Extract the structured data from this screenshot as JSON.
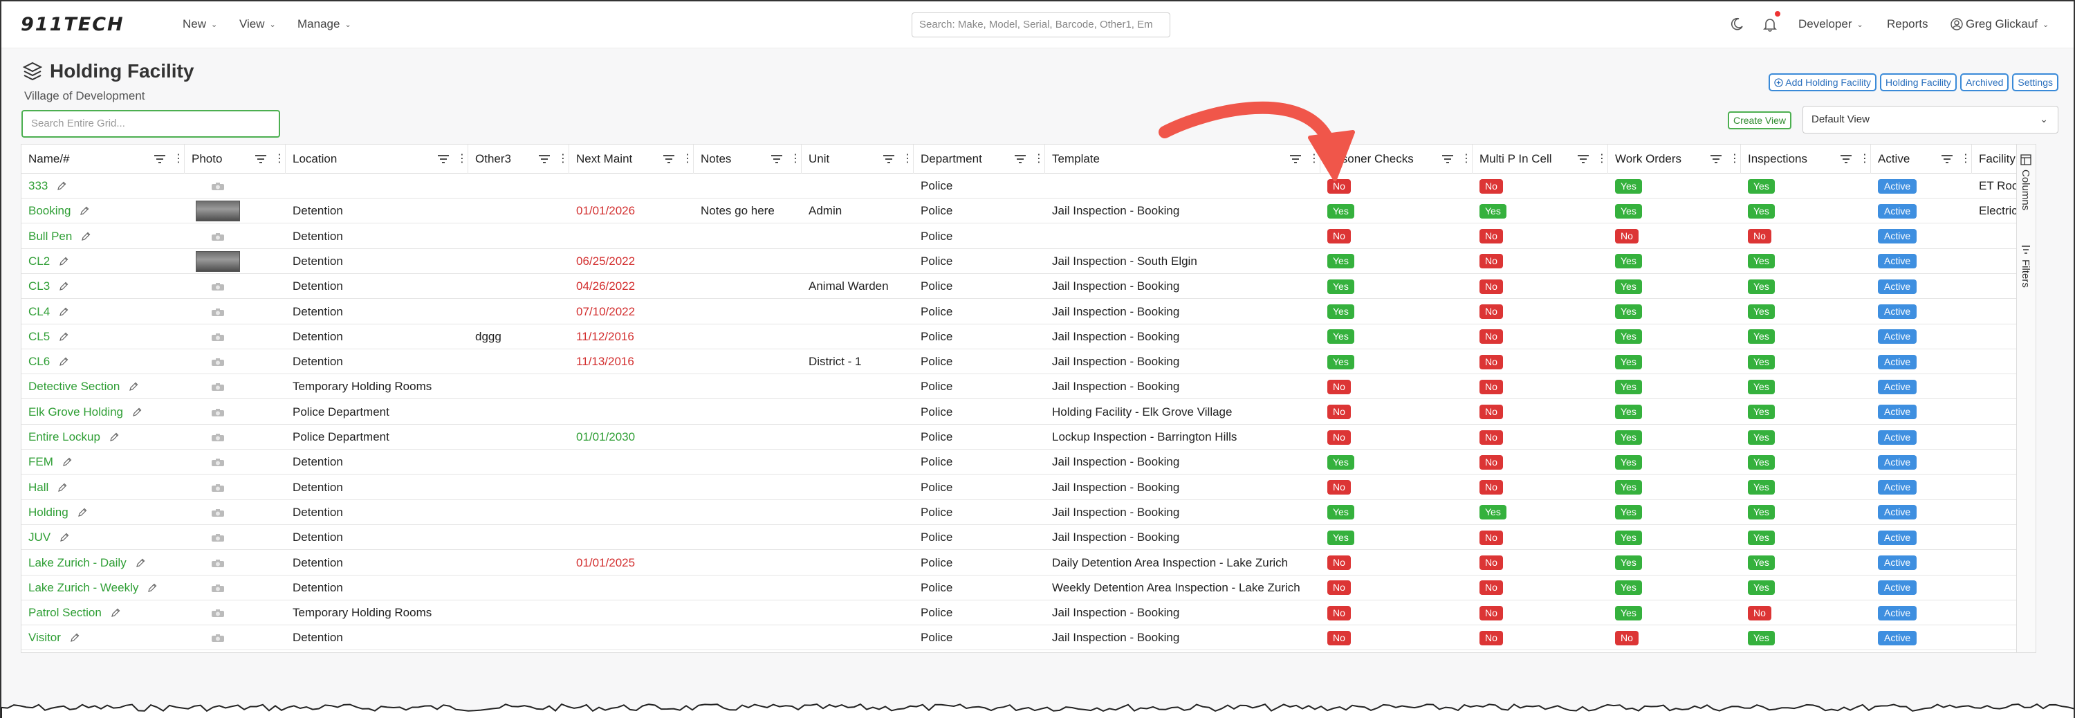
{
  "nav": {
    "logo": "911TECH",
    "new": "New",
    "view": "View",
    "manage": "Manage",
    "search_placeholder": "Search: Make, Model, Serial, Barcode, Other1, Em",
    "developer": "Developer",
    "reports": "Reports",
    "user": "Greg Glickauf"
  },
  "page": {
    "title": "Holding Facility",
    "subtitle": "Village of Development",
    "grid_search_placeholder": "Search Entire Grid...",
    "buttons": {
      "add": "Add Holding Facility",
      "holding": "Holding Facility",
      "archived": "Archived",
      "settings": "Settings"
    },
    "create_view": "Create View",
    "view_selected": "Default View"
  },
  "grid": {
    "columns": {
      "name": "Name/#",
      "photo": "Photo",
      "location": "Location",
      "other3": "Other3",
      "next_maint": "Next Maint",
      "notes": "Notes",
      "unit": "Unit",
      "department": "Department",
      "template": "Template",
      "prisoner_checks": "Prisoner Checks",
      "multi_p": "Multi P In Cell",
      "work_orders": "Work Orders",
      "inspections": "Inspections",
      "active": "Active",
      "facility": "Facility"
    },
    "side_tabs": {
      "columns": "Columns",
      "filters": "Filters"
    },
    "rows": [
      {
        "name": "333",
        "photo": "placeholder",
        "location": "",
        "other3": "",
        "next_maint": "",
        "next_maint_color": "",
        "notes": "",
        "unit": "",
        "department": "Police",
        "template": "",
        "prisoner_checks": "No",
        "multi_p": "No",
        "work_orders": "Yes",
        "inspections": "Yes",
        "active": "Active",
        "facility": "ET Room"
      },
      {
        "name": "Booking",
        "photo": "image",
        "location": "Detention",
        "other3": "",
        "next_maint": "01/01/2026",
        "next_maint_color": "red",
        "notes": "Notes go here",
        "unit": "Admin",
        "department": "Police",
        "template": "Jail Inspection - Booking",
        "prisoner_checks": "Yes",
        "multi_p": "Yes",
        "work_orders": "Yes",
        "inspections": "Yes",
        "active": "Active",
        "facility": "Electrical Clos"
      },
      {
        "name": "Bull Pen",
        "photo": "placeholder",
        "location": "Detention",
        "other3": "",
        "next_maint": "",
        "next_maint_color": "",
        "notes": "",
        "unit": "",
        "department": "Police",
        "template": "",
        "prisoner_checks": "No",
        "multi_p": "No",
        "work_orders": "No",
        "inspections": "No",
        "active": "Active",
        "facility": ""
      },
      {
        "name": "CL2",
        "photo": "image",
        "location": "Detention",
        "other3": "",
        "next_maint": "06/25/2022",
        "next_maint_color": "red",
        "notes": "",
        "unit": "",
        "department": "Police",
        "template": "Jail Inspection - South Elgin",
        "prisoner_checks": "Yes",
        "multi_p": "No",
        "work_orders": "Yes",
        "inspections": "Yes",
        "active": "Active",
        "facility": ""
      },
      {
        "name": "CL3",
        "photo": "placeholder",
        "location": "Detention",
        "other3": "",
        "next_maint": "04/26/2022",
        "next_maint_color": "red",
        "notes": "",
        "unit": "Animal Warden",
        "department": "Police",
        "template": "Jail Inspection - Booking",
        "prisoner_checks": "Yes",
        "multi_p": "No",
        "work_orders": "Yes",
        "inspections": "Yes",
        "active": "Active",
        "facility": ""
      },
      {
        "name": "CL4",
        "photo": "placeholder",
        "location": "Detention",
        "other3": "",
        "next_maint": "07/10/2022",
        "next_maint_color": "red",
        "notes": "",
        "unit": "",
        "department": "Police",
        "template": "Jail Inspection - Booking",
        "prisoner_checks": "Yes",
        "multi_p": "No",
        "work_orders": "Yes",
        "inspections": "Yes",
        "active": "Active",
        "facility": ""
      },
      {
        "name": "CL5",
        "photo": "placeholder",
        "location": "Detention",
        "other3": "dggg",
        "next_maint": "11/12/2016",
        "next_maint_color": "red",
        "notes": "",
        "unit": "",
        "department": "Police",
        "template": "Jail Inspection - Booking",
        "prisoner_checks": "Yes",
        "multi_p": "No",
        "work_orders": "Yes",
        "inspections": "Yes",
        "active": "Active",
        "facility": ""
      },
      {
        "name": "CL6",
        "photo": "placeholder",
        "location": "Detention",
        "other3": "",
        "next_maint": "11/13/2016",
        "next_maint_color": "red",
        "notes": "",
        "unit": "District - 1",
        "department": "Police",
        "template": "Jail Inspection - Booking",
        "prisoner_checks": "Yes",
        "multi_p": "No",
        "work_orders": "Yes",
        "inspections": "Yes",
        "active": "Active",
        "facility": ""
      },
      {
        "name": "Detective Section",
        "photo": "placeholder",
        "location": "Temporary Holding Rooms",
        "other3": "",
        "next_maint": "",
        "next_maint_color": "",
        "notes": "",
        "unit": "",
        "department": "Police",
        "template": "Jail Inspection - Booking",
        "prisoner_checks": "No",
        "multi_p": "No",
        "work_orders": "Yes",
        "inspections": "Yes",
        "active": "Active",
        "facility": ""
      },
      {
        "name": "Elk Grove Holding",
        "photo": "placeholder",
        "location": "Police Department",
        "other3": "",
        "next_maint": "",
        "next_maint_color": "",
        "notes": "",
        "unit": "",
        "department": "Police",
        "template": "Holding Facility - Elk Grove Village",
        "prisoner_checks": "No",
        "multi_p": "No",
        "work_orders": "Yes",
        "inspections": "Yes",
        "active": "Active",
        "facility": ""
      },
      {
        "name": "Entire Lockup",
        "photo": "placeholder",
        "location": "Police Department",
        "other3": "",
        "next_maint": "01/01/2030",
        "next_maint_color": "green",
        "notes": "",
        "unit": "",
        "department": "Police",
        "template": "Lockup Inspection - Barrington Hills",
        "prisoner_checks": "No",
        "multi_p": "No",
        "work_orders": "Yes",
        "inspections": "Yes",
        "active": "Active",
        "facility": ""
      },
      {
        "name": "FEM",
        "photo": "placeholder",
        "location": "Detention",
        "other3": "",
        "next_maint": "",
        "next_maint_color": "",
        "notes": "",
        "unit": "",
        "department": "Police",
        "template": "Jail Inspection - Booking",
        "prisoner_checks": "Yes",
        "multi_p": "No",
        "work_orders": "Yes",
        "inspections": "Yes",
        "active": "Active",
        "facility": ""
      },
      {
        "name": "Hall",
        "photo": "placeholder",
        "location": "Detention",
        "other3": "",
        "next_maint": "",
        "next_maint_color": "",
        "notes": "",
        "unit": "",
        "department": "Police",
        "template": "Jail Inspection - Booking",
        "prisoner_checks": "No",
        "multi_p": "No",
        "work_orders": "Yes",
        "inspections": "Yes",
        "active": "Active",
        "facility": ""
      },
      {
        "name": "Holding",
        "photo": "placeholder",
        "location": "Detention",
        "other3": "",
        "next_maint": "",
        "next_maint_color": "",
        "notes": "",
        "unit": "",
        "department": "Police",
        "template": "Jail Inspection - Booking",
        "prisoner_checks": "Yes",
        "multi_p": "Yes",
        "work_orders": "Yes",
        "inspections": "Yes",
        "active": "Active",
        "facility": ""
      },
      {
        "name": "JUV",
        "photo": "placeholder",
        "location": "Detention",
        "other3": "",
        "next_maint": "",
        "next_maint_color": "",
        "notes": "",
        "unit": "",
        "department": "Police",
        "template": "Jail Inspection - Booking",
        "prisoner_checks": "Yes",
        "multi_p": "No",
        "work_orders": "Yes",
        "inspections": "Yes",
        "active": "Active",
        "facility": ""
      },
      {
        "name": "Lake Zurich - Daily",
        "photo": "placeholder",
        "location": "Detention",
        "other3": "",
        "next_maint": "01/01/2025",
        "next_maint_color": "red",
        "notes": "",
        "unit": "",
        "department": "Police",
        "template": "Daily Detention Area Inspection - Lake Zurich",
        "prisoner_checks": "No",
        "multi_p": "No",
        "work_orders": "Yes",
        "inspections": "Yes",
        "active": "Active",
        "facility": ""
      },
      {
        "name": "Lake Zurich - Weekly",
        "photo": "placeholder",
        "location": "Detention",
        "other3": "",
        "next_maint": "",
        "next_maint_color": "",
        "notes": "",
        "unit": "",
        "department": "Police",
        "template": "Weekly Detention Area Inspection - Lake Zurich",
        "prisoner_checks": "No",
        "multi_p": "No",
        "work_orders": "Yes",
        "inspections": "Yes",
        "active": "Active",
        "facility": ""
      },
      {
        "name": "Patrol Section",
        "photo": "placeholder",
        "location": "Temporary Holding Rooms",
        "other3": "",
        "next_maint": "",
        "next_maint_color": "",
        "notes": "",
        "unit": "",
        "department": "Police",
        "template": "Jail Inspection - Booking",
        "prisoner_checks": "No",
        "multi_p": "No",
        "work_orders": "Yes",
        "inspections": "No",
        "active": "Active",
        "facility": ""
      },
      {
        "name": "Visitor",
        "photo": "placeholder",
        "location": "Detention",
        "other3": "",
        "next_maint": "",
        "next_maint_color": "",
        "notes": "",
        "unit": "",
        "department": "Police",
        "template": "Jail Inspection - Booking",
        "prisoner_checks": "No",
        "multi_p": "No",
        "work_orders": "No",
        "inspections": "Yes",
        "active": "Active",
        "facility": ""
      }
    ]
  },
  "colors": {
    "yes": "#35b13d",
    "no": "#dc3535",
    "active": "#3e8fe0",
    "link": "#2e9e34",
    "arrow": "#f0564a"
  }
}
